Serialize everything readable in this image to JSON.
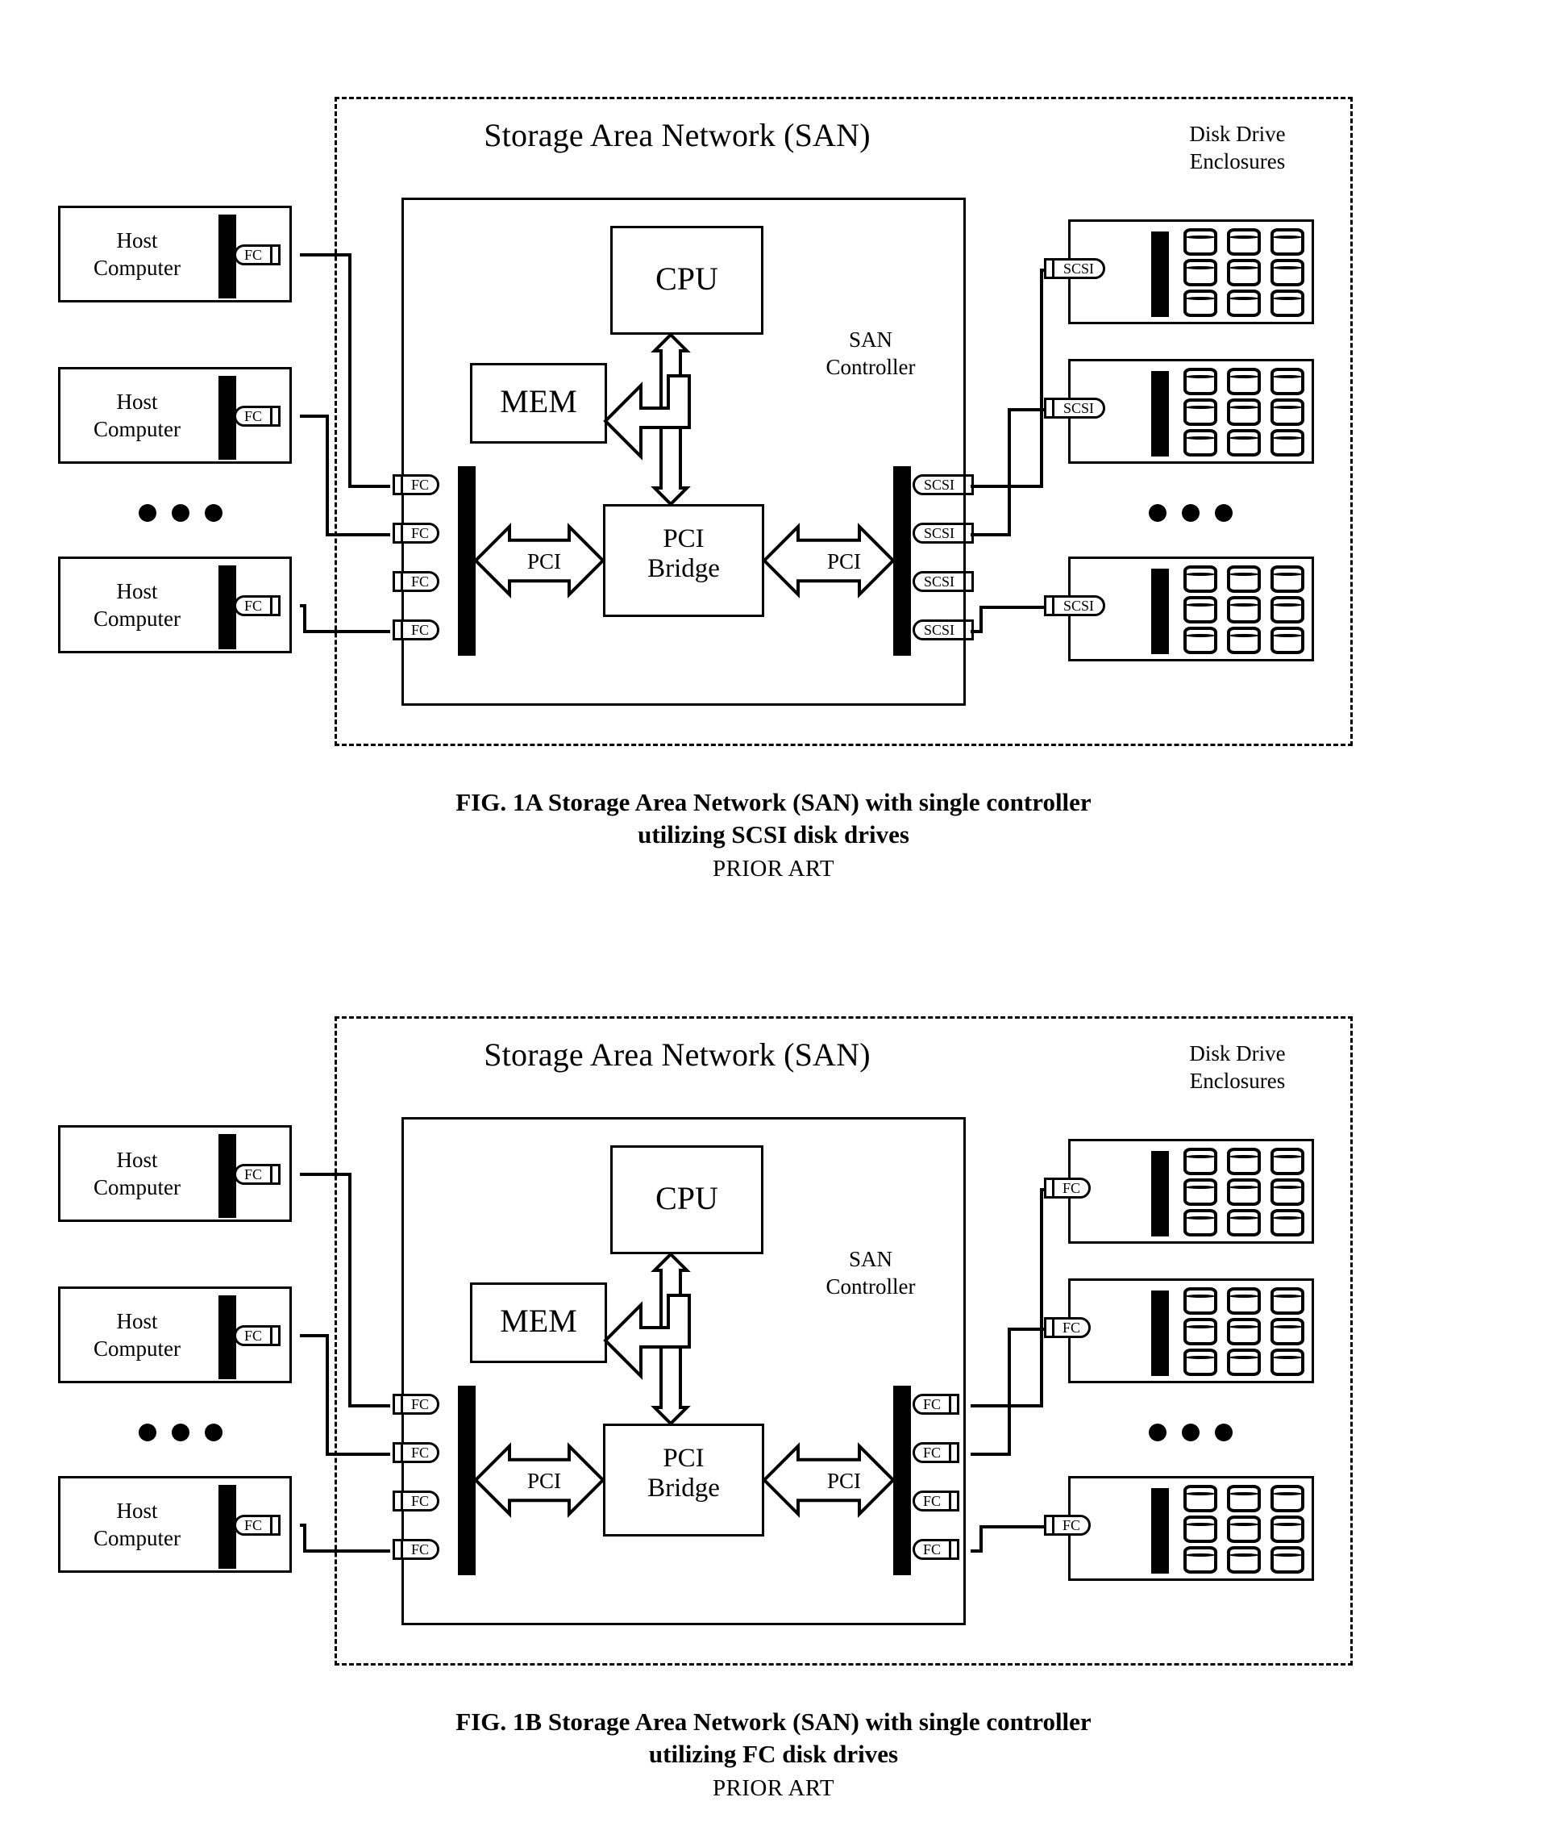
{
  "figures": [
    {
      "id": "fig-a",
      "san_title": "Storage Area Network (SAN)",
      "enclosures_title": "Disk Drive\nEnclosures",
      "controller_title": "SAN\nController",
      "cpu_label": "CPU",
      "mem_label": "MEM",
      "bridge_label": "PCI\nBridge",
      "bus_left_label": "PCI",
      "bus_right_label": "PCI",
      "host_label": "Host\nComputer",
      "hosts": [
        {
          "label": "Host\nComputer",
          "port": "FC"
        },
        {
          "label": "Host\nComputer",
          "port": "FC"
        },
        {
          "label": "Host\nComputer",
          "port": "FC"
        }
      ],
      "host_ellipsis": "• • •",
      "controller_front_ports": [
        "FC",
        "FC",
        "FC",
        "FC"
      ],
      "controller_back_ports": [
        "SCSI",
        "SCSI",
        "SCSI",
        "SCSI"
      ],
      "enclosures": [
        {
          "port": "SCSI",
          "drives": 9
        },
        {
          "port": "SCSI",
          "drives": 9
        },
        {
          "port": "SCSI",
          "drives": 9
        }
      ],
      "enclosure_ellipsis": "• • •",
      "caption_line1": "FIG. 1A Storage Area Network (SAN) with single controller",
      "caption_line2": "utilizing SCSI disk drives",
      "caption_line3": "PRIOR ART"
    },
    {
      "id": "fig-b",
      "san_title": "Storage Area Network (SAN)",
      "enclosures_title": "Disk Drive\nEnclosures",
      "controller_title": "SAN\nController",
      "cpu_label": "CPU",
      "mem_label": "MEM",
      "bridge_label": "PCI\nBridge",
      "bus_left_label": "PCI",
      "bus_right_label": "PCI",
      "host_label": "Host\nComputer",
      "hosts": [
        {
          "label": "Host\nComputer",
          "port": "FC"
        },
        {
          "label": "Host\nComputer",
          "port": "FC"
        },
        {
          "label": "Host\nComputer",
          "port": "FC"
        }
      ],
      "host_ellipsis": "• • •",
      "controller_front_ports": [
        "FC",
        "FC",
        "FC",
        "FC"
      ],
      "controller_back_ports": [
        "FC",
        "FC",
        "FC",
        "FC"
      ],
      "enclosures": [
        {
          "port": "FC",
          "drives": 9
        },
        {
          "port": "FC",
          "drives": 9
        },
        {
          "port": "FC",
          "drives": 9
        }
      ],
      "enclosure_ellipsis": "• • •",
      "caption_line1": "FIG. 1B Storage Area Network (SAN) with single controller",
      "caption_line2": "utilizing FC disk drives",
      "caption_line3": "PRIOR ART"
    }
  ],
  "colors": {
    "ink": "#000000",
    "paper": "#ffffff"
  }
}
